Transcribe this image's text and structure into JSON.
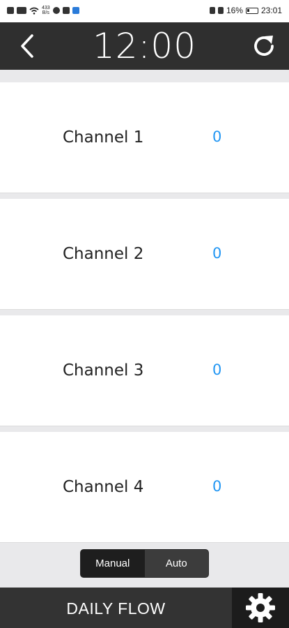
{
  "status_bar": {
    "data_rate_top": "433",
    "data_rate_bottom": "B/s",
    "battery_percent": "16%",
    "time": "23:01"
  },
  "header": {
    "clock": "12:00"
  },
  "channels": [
    {
      "label": "Channel 1",
      "value": "0"
    },
    {
      "label": "Channel 2",
      "value": "0"
    },
    {
      "label": "Channel 3",
      "value": "0"
    },
    {
      "label": "Channel 4",
      "value": "0"
    }
  ],
  "mode_toggle": {
    "manual_label": "Manual",
    "auto_label": "Auto",
    "selected": "Manual"
  },
  "bottom_bar": {
    "title": "DAILY FLOW"
  },
  "colors": {
    "accent_value": "#2196f3",
    "header_bg": "#2f2f2f",
    "bottom_bar_bg": "#333333"
  },
  "icons": [
    "back-arrow-icon",
    "refresh-icon",
    "gear-icon"
  ]
}
